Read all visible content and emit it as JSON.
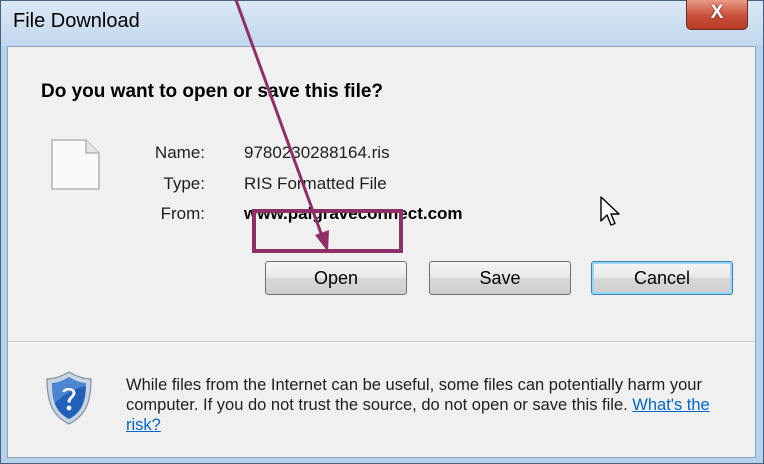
{
  "window": {
    "title": "File Download",
    "close_icon": "close-icon",
    "close_glyph": "X"
  },
  "dialog": {
    "question": "Do you want to open or save this file?",
    "file_icon": "blank-document-icon",
    "fields": [
      {
        "label": "Name:",
        "value": "9780230288164.ris"
      },
      {
        "label": "Type:",
        "value": "RIS Formatted File"
      },
      {
        "label": "From:",
        "value": "www.palgraveconnect.com"
      }
    ],
    "buttons": {
      "open": "Open",
      "save": "Save",
      "cancel": "Cancel"
    },
    "warning": {
      "icon": "security-shield-question-icon",
      "text": "While files from the Internet can be useful, some files can potentially harm your computer. If you do not trust the source, do not open or save this file.",
      "link": "What's the risk?"
    }
  },
  "overlay": {
    "arrow_icon": "annotation-arrow",
    "arrow_color": "#8e2f68",
    "highlight_color": "#8e2f68",
    "cursor_icon": "mouse-pointer-icon"
  }
}
